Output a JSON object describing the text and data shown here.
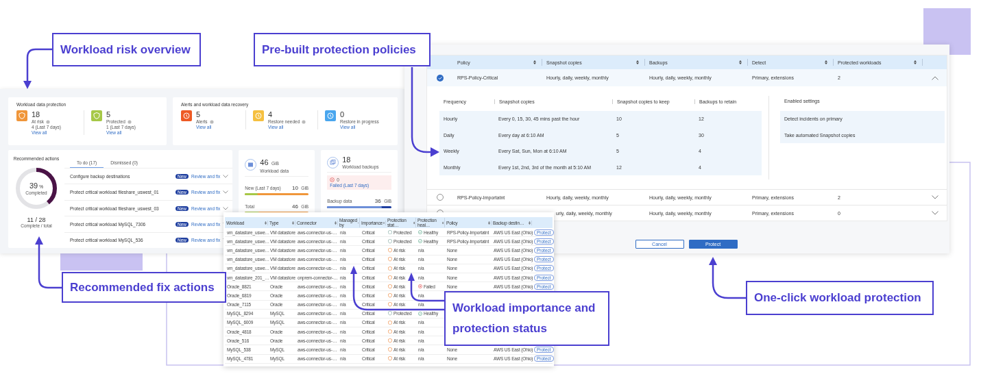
{
  "callouts": [
    {
      "text": "Workload risk overview"
    },
    {
      "text": "Pre-built protection policies"
    },
    {
      "text": "Recommended fix actions"
    },
    {
      "text": "Workload importance and protection status"
    },
    {
      "text": "One-click workload protection"
    }
  ],
  "dashboard": {
    "data_protection": {
      "title": "Workload data protection",
      "stats": [
        {
          "kind": "at_risk",
          "value": "18",
          "label": "At risk",
          "info": true,
          "sub": "4 (Last 7 days)",
          "link": "View all"
        },
        {
          "kind": "protected",
          "value": "5",
          "label": "Protected",
          "info": true,
          "sub": "1 (Last 7 days)",
          "link": "View all"
        }
      ]
    },
    "alerts": {
      "title": "Alerts and workload data recovery",
      "stats": [
        {
          "kind": "alert",
          "value": "5",
          "label": "Alerts",
          "info": true,
          "link": "View all"
        },
        {
          "kind": "restore",
          "value": "4",
          "label": "Restore needed",
          "info": true,
          "link": "View all"
        },
        {
          "kind": "restore_progress",
          "value": "0",
          "label": "Restore in progress",
          "info": false,
          "link": "View all"
        }
      ]
    },
    "recommended": {
      "title": "Recommended actions",
      "percent": "39",
      "percent_unit": "%",
      "percent_label": "Completed",
      "level": 0.39,
      "count": "11 / 28",
      "count_label": "Complete / total",
      "tabs": [
        {
          "label": "To do (17)",
          "selected": true
        },
        {
          "label": "Dismissed (0)",
          "selected": false
        }
      ],
      "actions": [
        {
          "text": "Configure backup destinations",
          "badge": "New",
          "link": "Review and fix"
        },
        {
          "text": "Protect critical workload fileshare_uswest_01",
          "badge": "New",
          "link": "Review and fix"
        },
        {
          "text": "Protect critical workload fileshare_uswest_03",
          "badge": "New",
          "link": "Review and fix"
        },
        {
          "text": "Protect critical workload MySQL_7306",
          "badge": "New",
          "link": "Review and fix"
        },
        {
          "text": "Protect critical workload MySQL_536",
          "badge": "New",
          "link": "Review and fix"
        }
      ]
    },
    "workload_data": {
      "value": "46",
      "unit": "GiB",
      "label": "Workload data",
      "bars": [
        {
          "label": "New (Last 7 days)",
          "value": "10",
          "unit": "GiB",
          "level": 0.2
        },
        {
          "label": "Total",
          "value": "46",
          "unit": "GiB",
          "level": 0.22
        }
      ]
    },
    "backups": {
      "value": "18",
      "label": "Workload backups",
      "failed_count": "0",
      "failed_link": "Failed (Last 7 days)",
      "backup_label": "Backup data",
      "backup_value": "36",
      "backup_unit": "GiB",
      "level": 0.85
    }
  },
  "policies": {
    "columns": [
      "Policy",
      "Snapshot copies",
      "Backups",
      "Detect",
      "Protected workloads"
    ],
    "rows": [
      {
        "selected": true,
        "expanded": true,
        "name": "RPS-Policy-Critical",
        "snapshot": "Hourly, daily, weekly, monthly",
        "backups": "Hourly, daily, weekly, monthly",
        "detect": "Primary, extensions",
        "protected": "2"
      },
      {
        "selected": false,
        "expanded": false,
        "name": "RPS-Policy-Importatnt",
        "snapshot": "Hourly, daily, weekly, monthly",
        "backups": "Hourly, daily, weekly, monthly",
        "detect": "Primary, extensions",
        "protected": "2"
      },
      {
        "selected": false,
        "expanded": false,
        "snapshot": "urly, daily, weekly, monthly",
        "backups": "Hourly, daily, weekly, monthly",
        "detect": "Primary, extensions",
        "protected": "0"
      }
    ],
    "details": {
      "columns": [
        "Frequency",
        "Snapshot copies",
        "Snapshot copies to keep",
        "Backups to retain"
      ],
      "rows": [
        [
          "Hourly",
          "Every 0, 15, 30, 45 mins past the hour",
          "10",
          "12"
        ],
        [
          "Daily",
          "Every day at 6:10 AM",
          "5",
          "30"
        ],
        [
          "Weekly",
          "Every Sat, Sun, Mon at 6:10 AM",
          "5",
          "4"
        ],
        [
          "Monthly",
          "Every 1st, 2nd, 3rd of the month at 5:10 AM",
          "12",
          "4"
        ]
      ],
      "settings_title": "Enabled settings",
      "settings": [
        "Detect incidents on primary",
        "Take automated Snapshot copies"
      ]
    },
    "buttons": [
      {
        "kind": "secondary",
        "label": "Cancel"
      },
      {
        "kind": "primary",
        "label": "Protect"
      }
    ]
  },
  "workloads": {
    "columns": [
      "Workload",
      "Type",
      "Connector",
      "Managed by",
      "Importance",
      "Protection stat…",
      "Protection heal…",
      "Policy",
      "Backup destin…"
    ],
    "rows": [
      {
        "workload": "vm_datastore_uswe…",
        "type": "VM datastore",
        "connector": "aws-connector-us-…",
        "managed_by": "n/a",
        "importance": "Critical",
        "status": {
          "kind": "protected",
          "label": "Protected"
        },
        "health": {
          "kind": "healthy",
          "label": "Healthy"
        },
        "policy": "RPS-Policy-Importatnt",
        "backup": "AWS US East (Ohio)",
        "action": "Protect"
      },
      {
        "workload": "vm_datastore_uswe…",
        "type": "VM datastore",
        "connector": "aws-connector-us-…",
        "managed_by": "n/a",
        "importance": "Critical",
        "status": {
          "kind": "protected",
          "label": "Protected"
        },
        "health": {
          "kind": "healthy",
          "label": "Healthy"
        },
        "policy": "RPS-Policy-Importatnt",
        "backup": "AWS US East (Ohio)",
        "action": "Protect"
      },
      {
        "workload": "vm_datastore_uswe…",
        "type": "VM datastore",
        "connector": "aws-connector-us-…",
        "managed_by": "n/a",
        "importance": "Critical",
        "status": {
          "kind": "at_risk",
          "label": "At risk"
        },
        "health": {
          "kind": "none",
          "label": "n/a"
        },
        "policy": "None",
        "backup": "AWS US East (Ohio)",
        "action": "Protect"
      },
      {
        "workload": "vm_datastore_uswe…",
        "type": "VM datastore",
        "connector": "aws-connector-us-…",
        "managed_by": "n/a",
        "importance": "Critical",
        "status": {
          "kind": "at_risk",
          "label": "At risk"
        },
        "health": {
          "kind": "none",
          "label": "n/a"
        },
        "policy": "None",
        "backup": "AWS US East (Ohio)",
        "action": "Protect"
      },
      {
        "workload": "vm_datastore_uswe…",
        "type": "VM datastore",
        "connector": "aws-connector-us-…",
        "managed_by": "n/a",
        "importance": "Critical",
        "status": {
          "kind": "at_risk",
          "label": "At risk"
        },
        "health": {
          "kind": "none",
          "label": "n/a"
        },
        "policy": "None",
        "backup": "AWS US East (Ohio)",
        "action": "Protect"
      },
      {
        "workload": "vm_datastore_201_…",
        "type": "VM datastore",
        "connector": "onprem-connector-…",
        "managed_by": "n/a",
        "importance": "Critical",
        "status": {
          "kind": "at_risk",
          "label": "At risk"
        },
        "health": {
          "kind": "none",
          "label": "n/a"
        },
        "policy": "None",
        "backup": "AWS US East (Ohio)",
        "action": "Protect"
      },
      {
        "workload": "Oracle_8821",
        "type": "Oracle",
        "connector": "aws-connector-us-…",
        "managed_by": "n/a",
        "importance": "Critical",
        "status": {
          "kind": "at_risk",
          "label": "At risk"
        },
        "health": {
          "kind": "failed",
          "label": "Failed"
        },
        "policy": "None",
        "backup": "AWS US East (Ohio)",
        "action": "Protect"
      },
      {
        "workload": "Oracle_6819",
        "type": "Oracle",
        "connector": "aws-connector-us-…",
        "managed_by": "n/a",
        "importance": "Critical",
        "status": {
          "kind": "at_risk",
          "label": "At risk"
        },
        "health": {
          "kind": "none",
          "label": "n/a"
        }
      },
      {
        "workload": "Oracle_7115",
        "type": "Oracle",
        "connector": "aws-connector-us-…",
        "managed_by": "n/a",
        "importance": "Critical",
        "status": {
          "kind": "at_risk",
          "label": "At risk"
        },
        "health": {
          "kind": "none",
          "label": "n/a"
        }
      },
      {
        "workload": "MySQL_8294",
        "type": "MySQL",
        "connector": "aws-connector-us-…",
        "managed_by": "n/a",
        "importance": "Critical",
        "status": {
          "kind": "protected",
          "label": "Protected"
        },
        "health": {
          "kind": "healthy",
          "label": "Healthy"
        }
      },
      {
        "workload": "MySQL_6009",
        "type": "MySQL",
        "connector": "aws-connector-us-…",
        "managed_by": "n/a",
        "importance": "Critical",
        "status": {
          "kind": "at_risk",
          "label": "At risk"
        },
        "health": {
          "kind": "none",
          "label": "n/a"
        }
      },
      {
        "workload": "Oracle_4818",
        "type": "Oracle",
        "connector": "aws-connector-us-…",
        "managed_by": "n/a",
        "importance": "Critical",
        "status": {
          "kind": "at_risk",
          "label": "At risk"
        },
        "health": {
          "kind": "none",
          "label": "n/a"
        }
      },
      {
        "workload": "Oracle_516",
        "type": "Oracle",
        "connector": "aws-connector-us-…",
        "managed_by": "n/a",
        "importance": "Critical",
        "status": {
          "kind": "at_risk",
          "label": "At risk"
        },
        "health": {
          "kind": "none",
          "label": "n/a"
        }
      },
      {
        "workload": "MySQL_538",
        "type": "MySQL",
        "connector": "aws-connector-us-…",
        "managed_by": "n/a",
        "importance": "Critical",
        "status": {
          "kind": "at_risk",
          "label": "At risk"
        },
        "health": {
          "kind": "none",
          "label": "n/a"
        },
        "policy": "None",
        "backup": "AWS US East (Ohio)",
        "action": "Protect"
      },
      {
        "workload": "MySQL_4781",
        "type": "MySQL",
        "connector": "aws-connector-us-…",
        "managed_by": "n/a",
        "importance": "Critical",
        "status": {
          "kind": "at_risk",
          "label": "At risk"
        },
        "health": {
          "kind": "none",
          "label": "n/a"
        },
        "policy": "None",
        "backup": "AWS US East (Ohio)",
        "action": "Protect"
      }
    ]
  }
}
